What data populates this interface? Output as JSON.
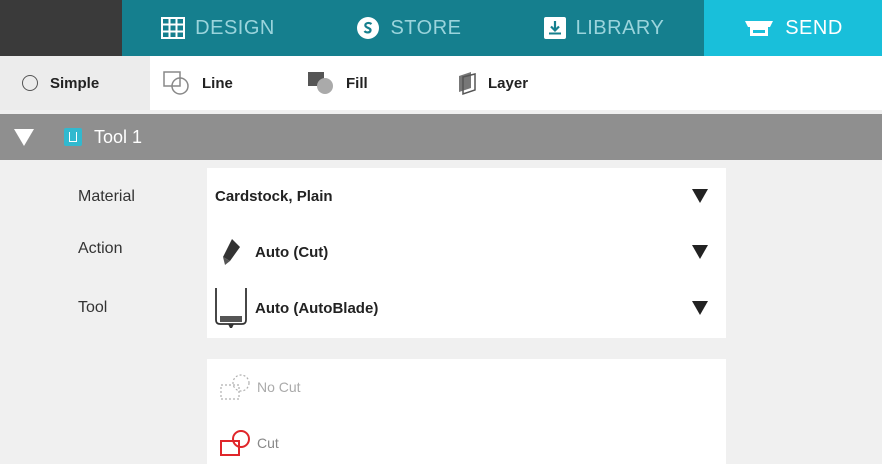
{
  "nav": {
    "tabs": [
      {
        "label": "DESIGN",
        "icon": "grid-icon"
      },
      {
        "label": "STORE",
        "icon": "store-s-icon"
      },
      {
        "label": "LIBRARY",
        "icon": "library-download-icon"
      },
      {
        "label": "SEND",
        "icon": "cutter-icon",
        "active": true
      }
    ],
    "colors": {
      "strip": "#157f8e",
      "active": "#19bfda",
      "inactive_text": "#9ad4dc"
    }
  },
  "modes": [
    {
      "label": "Simple",
      "icon": "radio-icon"
    },
    {
      "label": "Line",
      "icon": "line-mode-icon"
    },
    {
      "label": "Fill",
      "icon": "fill-mode-icon"
    },
    {
      "label": "Layer",
      "icon": "layer-mode-icon"
    }
  ],
  "tool": {
    "title": "Tool 1",
    "icon": "tool-chip-icon"
  },
  "settings": {
    "material": {
      "label": "Material",
      "value": "Cardstock, Plain"
    },
    "action": {
      "label": "Action",
      "value": "Auto (Cut)",
      "icon": "blade-pen-icon"
    },
    "tool": {
      "label": "Tool",
      "value": "Auto (AutoBlade)",
      "icon": "autoblade-icon"
    }
  },
  "cut_options": [
    {
      "label": "No Cut",
      "icon": "no-cut-icon"
    },
    {
      "label": "Cut",
      "icon": "cut-icon",
      "color": "#e0262a"
    }
  ]
}
